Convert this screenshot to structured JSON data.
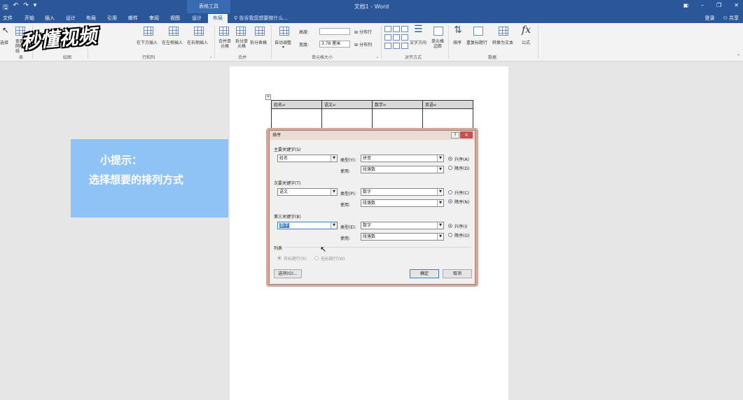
{
  "titlebar": {
    "context_tab": "表格工具",
    "doc_title": "文档1 - Word",
    "save_icon": "save-icon",
    "undo_icon": "undo-icon",
    "redo_icon": "redo-icon"
  },
  "tabs": {
    "file": "文件",
    "home": "开始",
    "insert": "插入",
    "design": "设计",
    "layout": "布局",
    "references": "引用",
    "mailings": "邮件",
    "review": "审阅",
    "view": "视图",
    "table_design": "设计",
    "table_layout": "布局",
    "tell_me": "告诉我您想要做什么...",
    "login": "登录",
    "share": "共享"
  },
  "ribbon": {
    "select": "选择",
    "view_gridlines": "查看网格线",
    "insert_below": "在下方插入",
    "insert_left": "在左侧插入",
    "insert_right": "在右侧插入",
    "merge_cells": "合并单元格",
    "split_cells": "拆分单元格",
    "split_table": "拆分表格",
    "autofit": "自动调整",
    "height_label": "高度:",
    "width_label": "宽度:",
    "width_value": "3.78 厘米",
    "distribute_rows": "分布行",
    "distribute_cols": "分布列",
    "text_direction": "文字方向",
    "cell_margins": "单元格边距",
    "sort": "排序",
    "repeat_header": "重复标题行",
    "convert_text": "转换为文本",
    "formula": "公式",
    "formula_icon": "fx",
    "groups": {
      "table": "表",
      "draw": "绘图",
      "rows_cols": "行和列",
      "merge": "合并",
      "cell_size": "单元格大小",
      "alignment": "对齐方式",
      "data": "数据"
    }
  },
  "doc_table": {
    "headers": [
      "姓名↵",
      "语文↵",
      "数学↵",
      "英语↵"
    ]
  },
  "tip": {
    "line1": "小提示：",
    "line2": "选择想要的排列方式"
  },
  "logo": {
    "text": "秒懂视频"
  },
  "dialog": {
    "title": "排序",
    "help": "?",
    "close": "×",
    "primary_key_label": "主要关键字(S)",
    "secondary_key_label": "次要关键字(T)",
    "third_key_label": "第三关键字(B)",
    "type_y": "类型(Y):",
    "type_p": "类型(P):",
    "type_e": "类型(E):",
    "using": "使用:",
    "keys": [
      {
        "field": "姓名",
        "type": "拼音",
        "using": "段落数",
        "ascending": "升序(A)",
        "descending": "降序(D)",
        "selected": "ascending"
      },
      {
        "field": "语文",
        "type": "数字",
        "using": "段落数",
        "ascending": "升序(C)",
        "descending": "降序(N)",
        "selected": "descending"
      },
      {
        "field": "数学",
        "type": "数字",
        "using": "段落数",
        "ascending": "升序(I)",
        "descending": "降序(G)",
        "selected": "ascending"
      }
    ],
    "list_label": "列表",
    "has_header": "有标题行(R)",
    "no_header": "无标题行(W)",
    "options_button": "选项(O)...",
    "ok_button": "确定",
    "cancel_button": "取消"
  }
}
